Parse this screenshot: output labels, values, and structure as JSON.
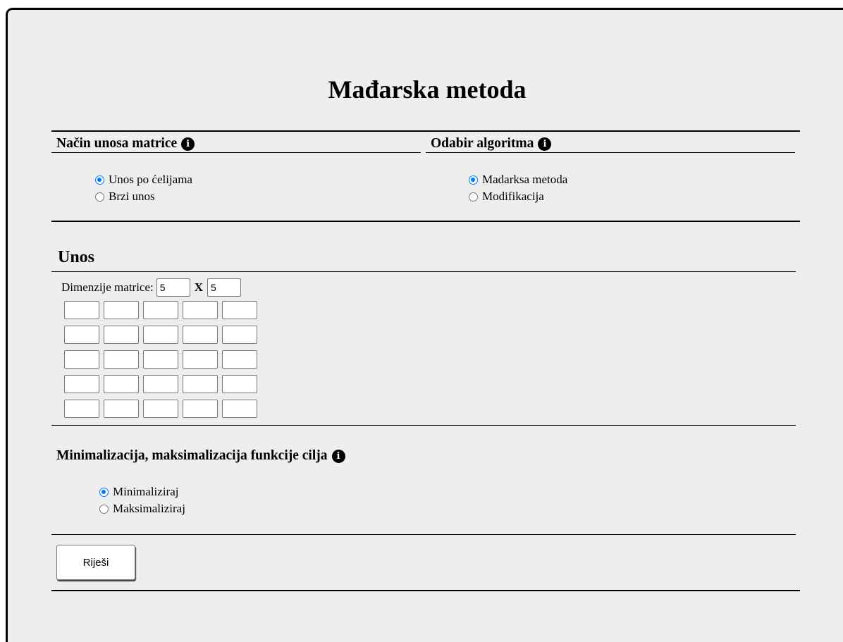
{
  "page": {
    "title": "Mađarska metoda"
  },
  "input_mode": {
    "heading": "Način unosa matrice",
    "options": [
      {
        "label": "Unos po ćelijama",
        "checked": true
      },
      {
        "label": "Brzi unos",
        "checked": false
      }
    ]
  },
  "algorithm": {
    "heading": "Odabir algoritma",
    "options": [
      {
        "label": "Madarksa metoda",
        "checked": true
      },
      {
        "label": "Modifikacija",
        "checked": false
      }
    ]
  },
  "entry": {
    "heading": "Unos",
    "dimensions_label": "Dimenzije matrice:",
    "rows_value": "5",
    "separator": "X",
    "cols_value": "5",
    "matrix_rows": 5,
    "matrix_cols": 5
  },
  "objective": {
    "heading": "Minimalizacija, maksimalizacija funkcije cilja",
    "options": [
      {
        "label": "Minimaliziraj",
        "checked": true
      },
      {
        "label": "Maksimaliziraj",
        "checked": false
      }
    ]
  },
  "actions": {
    "solve_label": "Riješi"
  },
  "icons": {
    "info": "info-icon"
  },
  "colors": {
    "panel_background": "#eeeeee",
    "radio_accent": "#0075ff"
  }
}
